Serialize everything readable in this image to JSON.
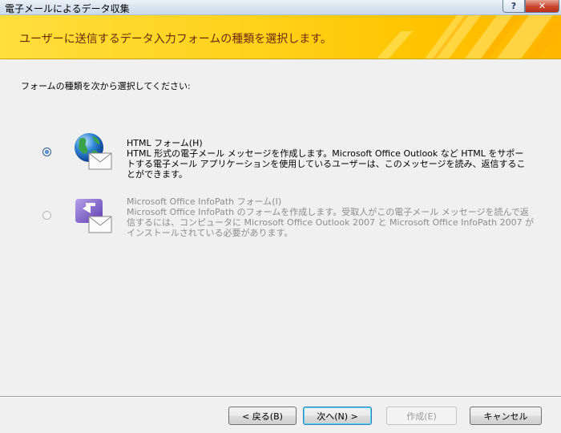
{
  "window": {
    "title": "電子メールによるデータ収集",
    "help_button": "?",
    "close_button": "✕"
  },
  "banner": {
    "heading": "ユーザーに送信するデータ入力フォームの種類を選択します。"
  },
  "instruction": "フォームの種類を次から選択してください:",
  "options": [
    {
      "title": "HTML フォーム(H)",
      "description": "HTML 形式の電子メール メッセージを作成します。Microsoft Office Outlook など HTML をサポートする電子メール アプリケーションを使用しているユーザーは、このメッセージを読み、返信することができます。",
      "selected": true,
      "enabled": true,
      "icon": "globe-envelope-icon"
    },
    {
      "title": "Microsoft Office InfoPath フォーム(I)",
      "description": "Microsoft Office InfoPath のフォームを作成します。受取人がこの電子メール メッセージを読んで返信するには、コンピュータに Microsoft Office Outlook 2007 と Microsoft Office InfoPath 2007 がインストールされている必要があります。",
      "selected": false,
      "enabled": false,
      "icon": "infopath-envelope-icon"
    }
  ],
  "buttons": {
    "back": "< 戻る(B)",
    "next": "次へ(N) >",
    "create": "作成(E)",
    "cancel": "キャンセル"
  },
  "colors": {
    "banner_yellow": "#ffd21c",
    "heading_text": "#6b2a00",
    "disabled_text": "#8d8d8d"
  }
}
